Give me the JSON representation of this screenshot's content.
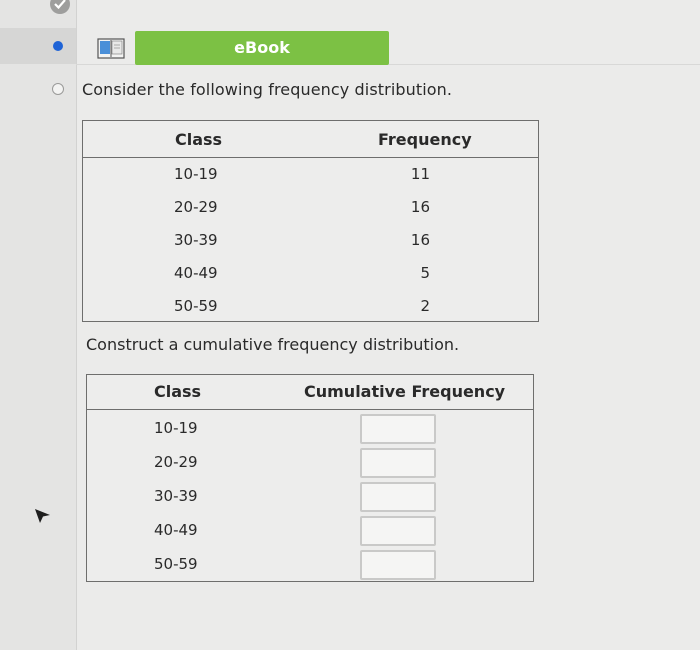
{
  "ebook": {
    "label": "eBook"
  },
  "question": {
    "prompt": "Consider the following frequency distribution.",
    "instruction": "Construct a cumulative frequency distribution."
  },
  "frequency_table": {
    "headers": {
      "class": "Class",
      "frequency": "Frequency"
    },
    "rows": [
      {
        "class": "10-19",
        "frequency": "11"
      },
      {
        "class": "20-29",
        "frequency": "16"
      },
      {
        "class": "30-39",
        "frequency": "16"
      },
      {
        "class": "40-49",
        "frequency": "5"
      },
      {
        "class": "50-59",
        "frequency": "2"
      }
    ]
  },
  "cumulative_table": {
    "headers": {
      "class": "Class",
      "cumulative": "Cumulative Frequency"
    },
    "rows": [
      {
        "class": "10-19",
        "value": ""
      },
      {
        "class": "20-29",
        "value": ""
      },
      {
        "class": "30-39",
        "value": ""
      },
      {
        "class": "40-49",
        "value": ""
      },
      {
        "class": "50-59",
        "value": ""
      }
    ]
  },
  "colors": {
    "ebook_button": "#7cc144",
    "active_dot": "#1f63d6",
    "background": "#ebebea"
  },
  "icons": [
    "check-icon",
    "book-icon",
    "cursor-icon"
  ]
}
